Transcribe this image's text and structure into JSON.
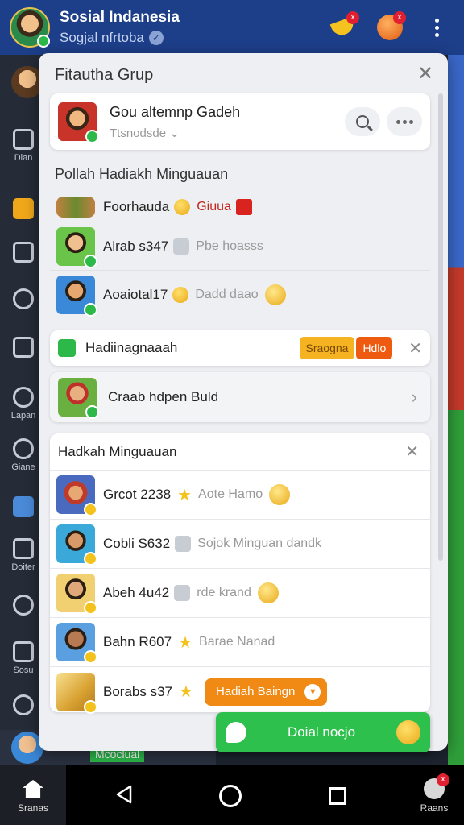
{
  "app": {
    "title": "Sosial Indanesia",
    "subtitle": "Sogjal nfrtoba",
    "badge_banana": "x",
    "badge_orange": "x"
  },
  "rail": {
    "items": [
      "Dian",
      "Lapan",
      "Giane",
      "Doiter",
      "Sosu"
    ]
  },
  "modal": {
    "title": "Fitautha Grup",
    "close_label": "✕"
  },
  "group": {
    "name": "Gou altemnp Gadeh",
    "sub": "Ttsnodsde",
    "chevron": "⌄"
  },
  "weekly_list": {
    "title": "Pollah Hadiakh Minguauan",
    "rows": [
      {
        "name": "Foorhauda",
        "note": "Giuua"
      },
      {
        "name": "Alrab s347",
        "note": "Pbe hoasss"
      },
      {
        "name": "Aoaiotal17",
        "note": "Dadd daao"
      }
    ]
  },
  "promo": {
    "label": "Hadiinagnaaah",
    "pill_yellow": "Sraogna",
    "pill_orange": "Hdlo",
    "close": "✕"
  },
  "nav_card": {
    "label": "Craab hdpen Buld",
    "chevron": "›"
  },
  "gifts": {
    "title": "Hadkah Minguauan",
    "close": "✕",
    "rows": [
      {
        "name": "Grcot 2238",
        "note": "Aote Hamo"
      },
      {
        "name": "Cobli S632",
        "note": "Sojok Minguan dandk"
      },
      {
        "name": "Abeh 4u42",
        "note": "rde krand"
      },
      {
        "name": "Bahn R607",
        "note": "Barae Nanad"
      },
      {
        "name": "Borabs s37",
        "claim_label": "Hadiah Baingn"
      }
    ]
  },
  "fab": {
    "label": "Doial nocjo"
  },
  "under": {
    "tag": "Mcoclual"
  },
  "bottom_nav": {
    "home_label": "Sranas",
    "right_label": "Raans",
    "right_badge": "x"
  },
  "colors": {
    "topbar": "#1d3f8a",
    "accent_green": "#2ec04c",
    "accent_orange": "#f08a14",
    "star": "#f3c21c"
  }
}
